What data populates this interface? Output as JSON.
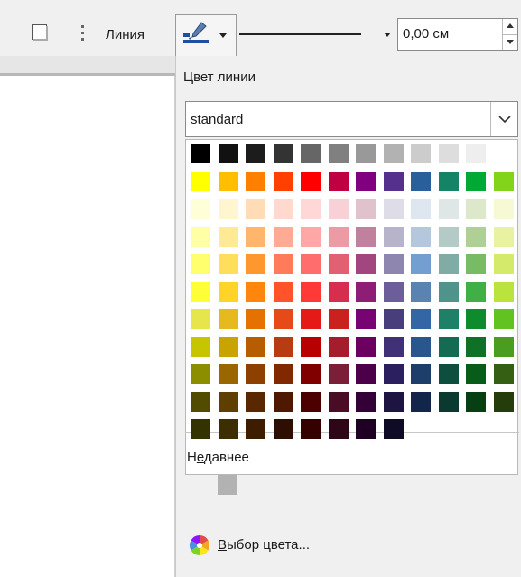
{
  "toolbar": {
    "shape_icon": "square-icon",
    "more_icon": "vertical-dots-icon",
    "line_label": "Линия",
    "line_color_icon": "brush-line-color-icon",
    "line_color_accent": "#1d4fa3",
    "line_width_value": "0,00 см"
  },
  "popup": {
    "title": "Цвет линии",
    "palette_select": "standard",
    "colors": [
      "#000000",
      "#111111",
      "#1c1c1c",
      "#333333",
      "#666666",
      "#808080",
      "#999999",
      "#b2b2b2",
      "#cccccc",
      "#dddddd",
      "#eeeeee",
      "#ffffff",
      "#ffff00",
      "#ffbf00",
      "#ff8000",
      "#ff4000",
      "#ff0000",
      "#bf0041",
      "#800080",
      "#55308d",
      "#2a6099",
      "#158466",
      "#00a933",
      "#81d41a",
      "#ffffd7",
      "#fff5ce",
      "#ffdbb6",
      "#ffd8ce",
      "#ffd7d7",
      "#f7d1d5",
      "#e0c2cd",
      "#dedce6",
      "#dee6ef",
      "#dee7e5",
      "#dde8cb",
      "#f6f9d4",
      "#ffffa6",
      "#ffe994",
      "#ffb66c",
      "#ffaa95",
      "#ffa6a6",
      "#ec9ba4",
      "#bf819e",
      "#b7b3ca",
      "#b4c7dc",
      "#b3cac7",
      "#afd095",
      "#e8f2a1",
      "#ffff6d",
      "#ffde59",
      "#ff972f",
      "#ff7b59",
      "#ff6d6d",
      "#e16173",
      "#a1467e",
      "#8e86ae",
      "#729fcf",
      "#81aca6",
      "#77bc65",
      "#d4ea6b",
      "#ffff38",
      "#ffd428",
      "#ff860d",
      "#ff5429",
      "#ff3838",
      "#d62e4e",
      "#8d1d75",
      "#6b5e9b",
      "#5983b0",
      "#50938a",
      "#3faf46",
      "#bbe33d",
      "#e6e64c",
      "#e6b91e",
      "#e57100",
      "#e64a19",
      "#e61919",
      "#c9211e",
      "#780373",
      "#483e7c",
      "#3465a4",
      "#1e8066",
      "#0e8c2d",
      "#62c221",
      "#c5c500",
      "#c9a300",
      "#b85c00",
      "#b83c12",
      "#b80000",
      "#a51d2d",
      "#6b0061",
      "#3f3078",
      "#2a568e",
      "#136b54",
      "#0d7227",
      "#4a9d1e",
      "#8d8d00",
      "#996600",
      "#8d4000",
      "#802800",
      "#800000",
      "#7b1e38",
      "#4c0049",
      "#2c1f5f",
      "#1d3e6b",
      "#0e4e3f",
      "#075c1a",
      "#355f13",
      "#524c00",
      "#5e3f00",
      "#5a2800",
      "#4e1900",
      "#4d0000",
      "#4a0c25",
      "#330038",
      "#1d1442",
      "#11264a",
      "#0a3a2f",
      "#063f11",
      "#253d0b",
      "#333300",
      "#3d2e00",
      "#3d1c00",
      "#2e0e00",
      "#340000",
      "#2e0618",
      "#1f0024",
      "#0f0a25"
    ],
    "selected_color": "#2a6099",
    "recent_label_prefix": "Н",
    "recent_label_underlined": "е",
    "recent_label_suffix": "давнее",
    "recent_colors": [
      "#b2b2b2"
    ],
    "custom_icon": "color-wheel-icon",
    "custom_underlined": "В",
    "custom_label_suffix": "ыбор цвета..."
  }
}
